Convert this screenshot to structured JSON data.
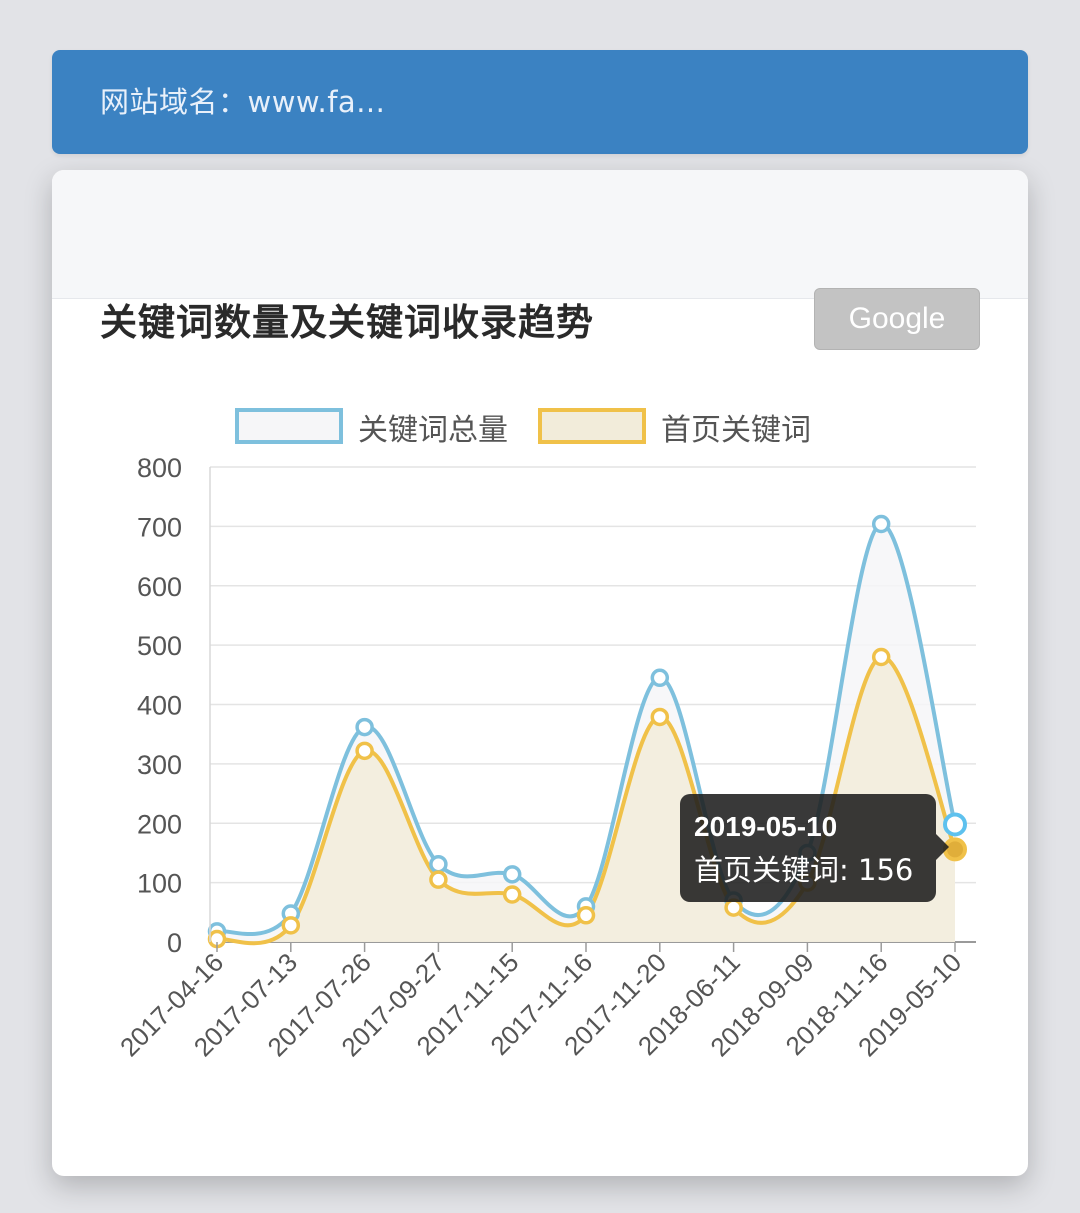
{
  "header": {
    "domain_label": "网站域名：www.fa..."
  },
  "card": {
    "title": "关键词数量及关键词收录趋势",
    "engine_button": "Google"
  },
  "chart_data": {
    "type": "line",
    "style": "smooth-area",
    "categories": [
      "2017-04-16",
      "2017-07-13",
      "2017-07-26",
      "2017-09-27",
      "2017-11-15",
      "2017-11-16",
      "2017-11-20",
      "2018-06-11",
      "2018-09-09",
      "2018-11-16",
      "2019-05-10"
    ],
    "series": [
      {
        "name": "关键词总量",
        "color": "#7ec0dd",
        "fill": "#f6f6f8",
        "values": [
          18,
          48,
          362,
          131,
          114,
          60,
          445,
          70,
          150,
          704,
          198
        ]
      },
      {
        "name": "首页关键词",
        "color": "#f0c149",
        "fill": "#f2ecda",
        "values": [
          5,
          28,
          322,
          105,
          80,
          45,
          379,
          58,
          100,
          480,
          156
        ]
      }
    ],
    "ylim": [
      0,
      800
    ],
    "yticks": [
      0,
      100,
      200,
      300,
      400,
      500,
      600,
      700,
      800
    ],
    "grid": true,
    "legend": "top-center",
    "tooltip": {
      "title": "2019-05-10",
      "series": "首页关键词",
      "value": "156",
      "line": "首页关键词: 156"
    }
  }
}
